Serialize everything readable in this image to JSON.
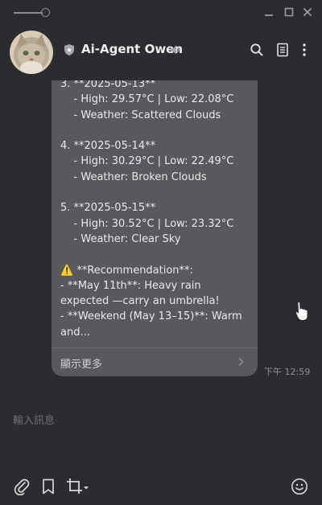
{
  "window": {
    "controls": [
      "minimize-icon",
      "maximize-icon",
      "close-icon"
    ]
  },
  "header": {
    "agent_name": "Ai-Agent Owen",
    "icons": [
      "shield-icon",
      "speaker-icon",
      "search-icon",
      "notes-icon",
      "more-vertical-icon"
    ]
  },
  "message": {
    "text": "3. **2025-05-13**\n    - High: 29.57°C | Low: 22.08°C\n    - Weather: Scattered Clouds\n\n4. **2025-05-14**\n    - High: 30.29°C | Low: 22.49°C\n    - Weather: Broken Clouds\n\n5. **2025-05-15**\n    - High: 30.52°C | Low: 23.32°C\n    - Weather: Clear Sky\n\n⚠️ **Recommendation**:\n- **May 11th**: Heavy rain expected —carry an umbrella!\n- **Weekend (May 13–15)**: Warm and...",
    "show_more": "顯示更多",
    "timestamp": "下午 12:59"
  },
  "input": {
    "placeholder": "輸入訊息"
  },
  "toolbar": {
    "icons": [
      "paperclip-icon",
      "bookmark-icon",
      "crop-icon",
      "emoji-icon"
    ]
  },
  "colors": {
    "background": "#2b2c30",
    "bubble": "#58595d",
    "text": "#e9e9e9",
    "muted": "#8e8f94"
  }
}
